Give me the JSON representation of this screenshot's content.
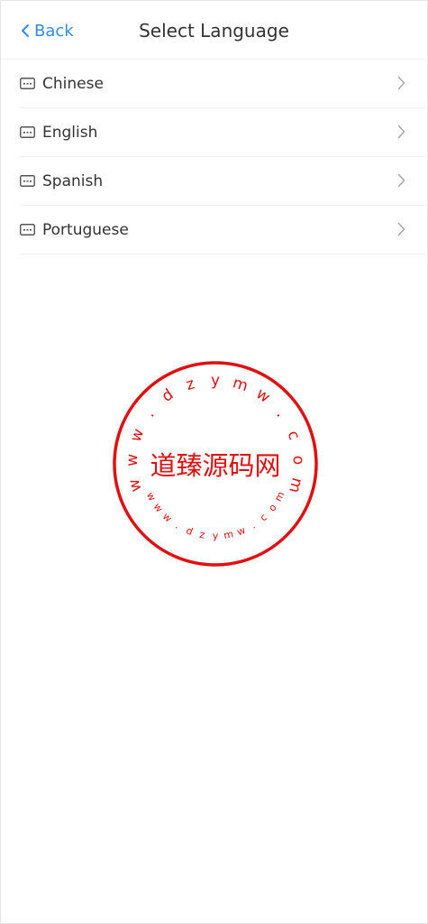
{
  "header": {
    "back_label": "Back",
    "title": "Select Language"
  },
  "languages": [
    {
      "label": "Chinese"
    },
    {
      "label": "English"
    },
    {
      "label": "Spanish"
    },
    {
      "label": "Portuguese"
    }
  ],
  "icons": {
    "back": "chevron-left-icon",
    "item": "keyboard-icon",
    "item_arrow": "chevron-right-icon"
  },
  "colors": {
    "accent": "#2f8bf2",
    "text": "#333333",
    "arrow": "#a9a9a9",
    "divider": "#f1f1f1",
    "watermark": "#e01010"
  },
  "watermark": {
    "center_text": "道臻源码网",
    "outer_ring_chars": [
      "w",
      "w",
      "w",
      ".",
      "d",
      "z",
      "y",
      "m",
      "w",
      ".",
      "c",
      "o",
      "m"
    ],
    "inner_ring_chars": [
      "w",
      "w",
      "w",
      ".",
      "d",
      "z",
      "y",
      "m",
      "w",
      ".",
      "c",
      "o",
      "m"
    ]
  }
}
